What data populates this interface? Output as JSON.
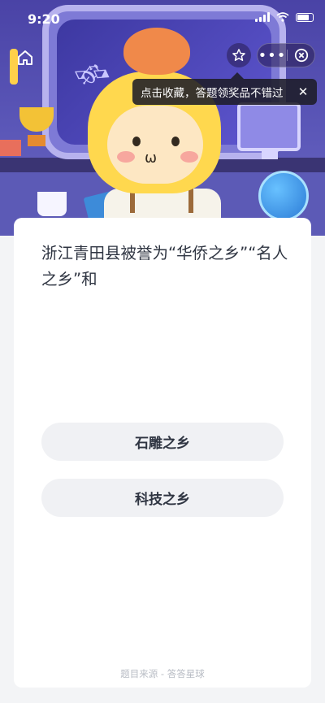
{
  "status_bar": {
    "time": "9:20"
  },
  "tooltip": {
    "text": "点击收藏，答题领奖品不错过",
    "close_symbol": "✕"
  },
  "nav": {
    "more_symbol": "•••"
  },
  "question": {
    "text": "浙江青田县被誉为“华侨之乡”“名人之乡”和"
  },
  "options": [
    {
      "label": "石雕之乡"
    },
    {
      "label": "科技之乡"
    }
  ],
  "footer": {
    "source": "题目来源 - 答答星球"
  },
  "colors": {
    "hero_bg": "#4a43a6",
    "card_bg": "#ffffff",
    "option_bg": "#f0f1f4",
    "text_primary": "#2f3542",
    "text_muted": "#b8bcc4"
  },
  "icons": [
    "home-icon",
    "star-icon",
    "more-icon",
    "close-circle-icon",
    "wifi-icon",
    "signal-icon",
    "battery-icon"
  ]
}
